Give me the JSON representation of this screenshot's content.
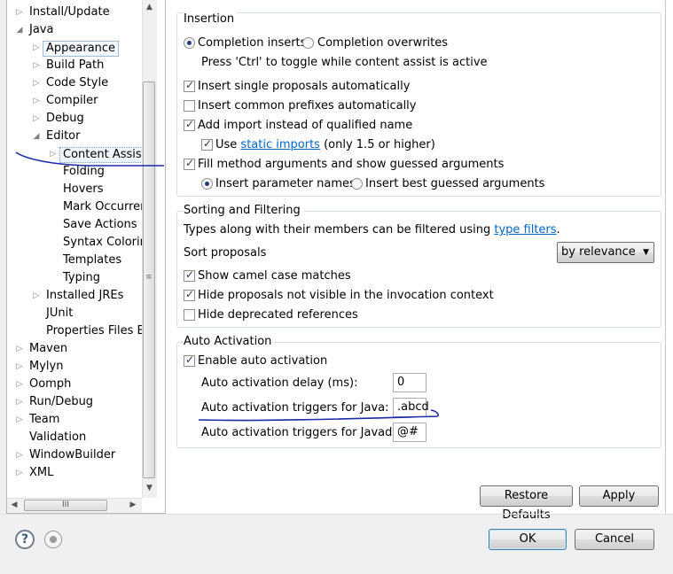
{
  "tree": {
    "items": [
      {
        "label": "Install/Update",
        "state": "collapsed"
      },
      {
        "label": "Java",
        "state": "expanded"
      },
      {
        "label": "Appearance",
        "state": "collapsed"
      },
      {
        "label": "Build Path",
        "state": "collapsed"
      },
      {
        "label": "Code Style",
        "state": "collapsed"
      },
      {
        "label": "Compiler",
        "state": "collapsed"
      },
      {
        "label": "Debug",
        "state": "collapsed"
      },
      {
        "label": "Editor",
        "state": "expanded"
      },
      {
        "label": "Content Assist",
        "state": "collapsed",
        "selected": true
      },
      {
        "label": "Folding"
      },
      {
        "label": "Hovers"
      },
      {
        "label": "Mark Occurren"
      },
      {
        "label": "Save Actions"
      },
      {
        "label": "Syntax Coloring"
      },
      {
        "label": "Templates"
      },
      {
        "label": "Typing"
      },
      {
        "label": "Installed JREs",
        "state": "collapsed"
      },
      {
        "label": "JUnit"
      },
      {
        "label": "Properties Files Ed"
      },
      {
        "label": "Maven",
        "state": "collapsed"
      },
      {
        "label": "Mylyn",
        "state": "collapsed"
      },
      {
        "label": "Oomph",
        "state": "collapsed"
      },
      {
        "label": "Run/Debug",
        "state": "collapsed"
      },
      {
        "label": "Team",
        "state": "collapsed"
      },
      {
        "label": "Validation"
      },
      {
        "label": "WindowBuilder",
        "state": "collapsed"
      },
      {
        "label": "XML",
        "state": "collapsed"
      }
    ],
    "hscroll_grip": "III"
  },
  "insertion": {
    "title": "Insertion",
    "completion_inserts": {
      "label": "Completion inserts",
      "checked": true
    },
    "completion_overwrites": {
      "label": "Completion overwrites",
      "checked": false
    },
    "hint": "Press 'Ctrl' to toggle while content assist is active",
    "single_proposals": {
      "label": "Insert single proposals automatically",
      "checked": true
    },
    "common_prefixes": {
      "label": "Insert common prefixes automatically",
      "checked": false
    },
    "add_import": {
      "label": "Add import instead of qualified name",
      "checked": true
    },
    "use_static": {
      "prefix": "Use ",
      "link": "static imports",
      "suffix": " (only 1.5 or higher)",
      "checked": true
    },
    "fill_args": {
      "label": "Fill method arguments and show guessed arguments",
      "checked": true
    },
    "param_names": {
      "label": "Insert parameter names",
      "checked": true
    },
    "best_guessed": {
      "label": "Insert best guessed arguments",
      "checked": false
    }
  },
  "sorting": {
    "title": "Sorting and Filtering",
    "types_text_prefix": "Types along with their members can be filtered using ",
    "types_link": "type filters",
    "types_text_suffix": ".",
    "sort_label": "Sort proposals",
    "sort_value": "by relevance",
    "camel_case": {
      "label": "Show camel case matches",
      "checked": true
    },
    "hide_invisible": {
      "label": "Hide proposals not visible in the invocation context",
      "checked": true
    },
    "hide_deprecated": {
      "label": "Hide deprecated references",
      "checked": false
    }
  },
  "auto_activation": {
    "title": "Auto Activation",
    "enable": {
      "label": "Enable auto activation",
      "checked": true
    },
    "delay_label": "Auto activation delay (ms):",
    "delay_value": "0",
    "java_label": "Auto activation triggers for Java:",
    "java_value": ".abcd",
    "javadoc_label": "Auto activation triggers for Javadoc:",
    "javadoc_value": "@#"
  },
  "buttons": {
    "restore_defaults": "Restore Defaults",
    "apply": "Apply",
    "ok": "OK",
    "cancel": "Cancel"
  },
  "icons": {
    "help": "?",
    "import_export": "circle"
  },
  "annotation_color": "#1a2aa8"
}
